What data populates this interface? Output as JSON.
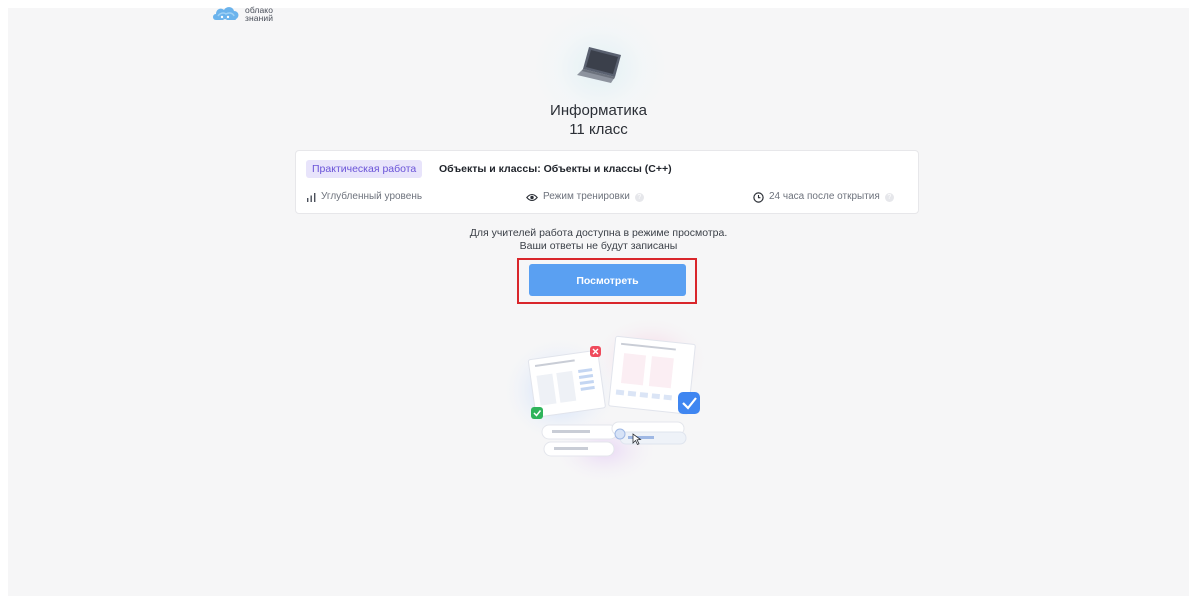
{
  "logo": {
    "line1": "облако",
    "line2": "знаний"
  },
  "subject": {
    "title": "Информатика",
    "grade": "11 класс"
  },
  "card": {
    "tag": "Практическая работа",
    "title": "Объекты и классы: Объекты и классы (C++)",
    "level": "Углубленный уровень",
    "mode": "Режим тренировки",
    "time": "24 часа после открытия"
  },
  "notice": {
    "line1": "Для учителей работа доступна в режиме просмотра.",
    "line2": "Ваши ответы не будут записаны"
  },
  "view_button": {
    "label": "Посмотреть"
  },
  "colors": {
    "accent": "#5aa0f2",
    "tag_bg": "#e8e4fb",
    "tag_text": "#6a53d8",
    "highlight": "#d9262b"
  }
}
